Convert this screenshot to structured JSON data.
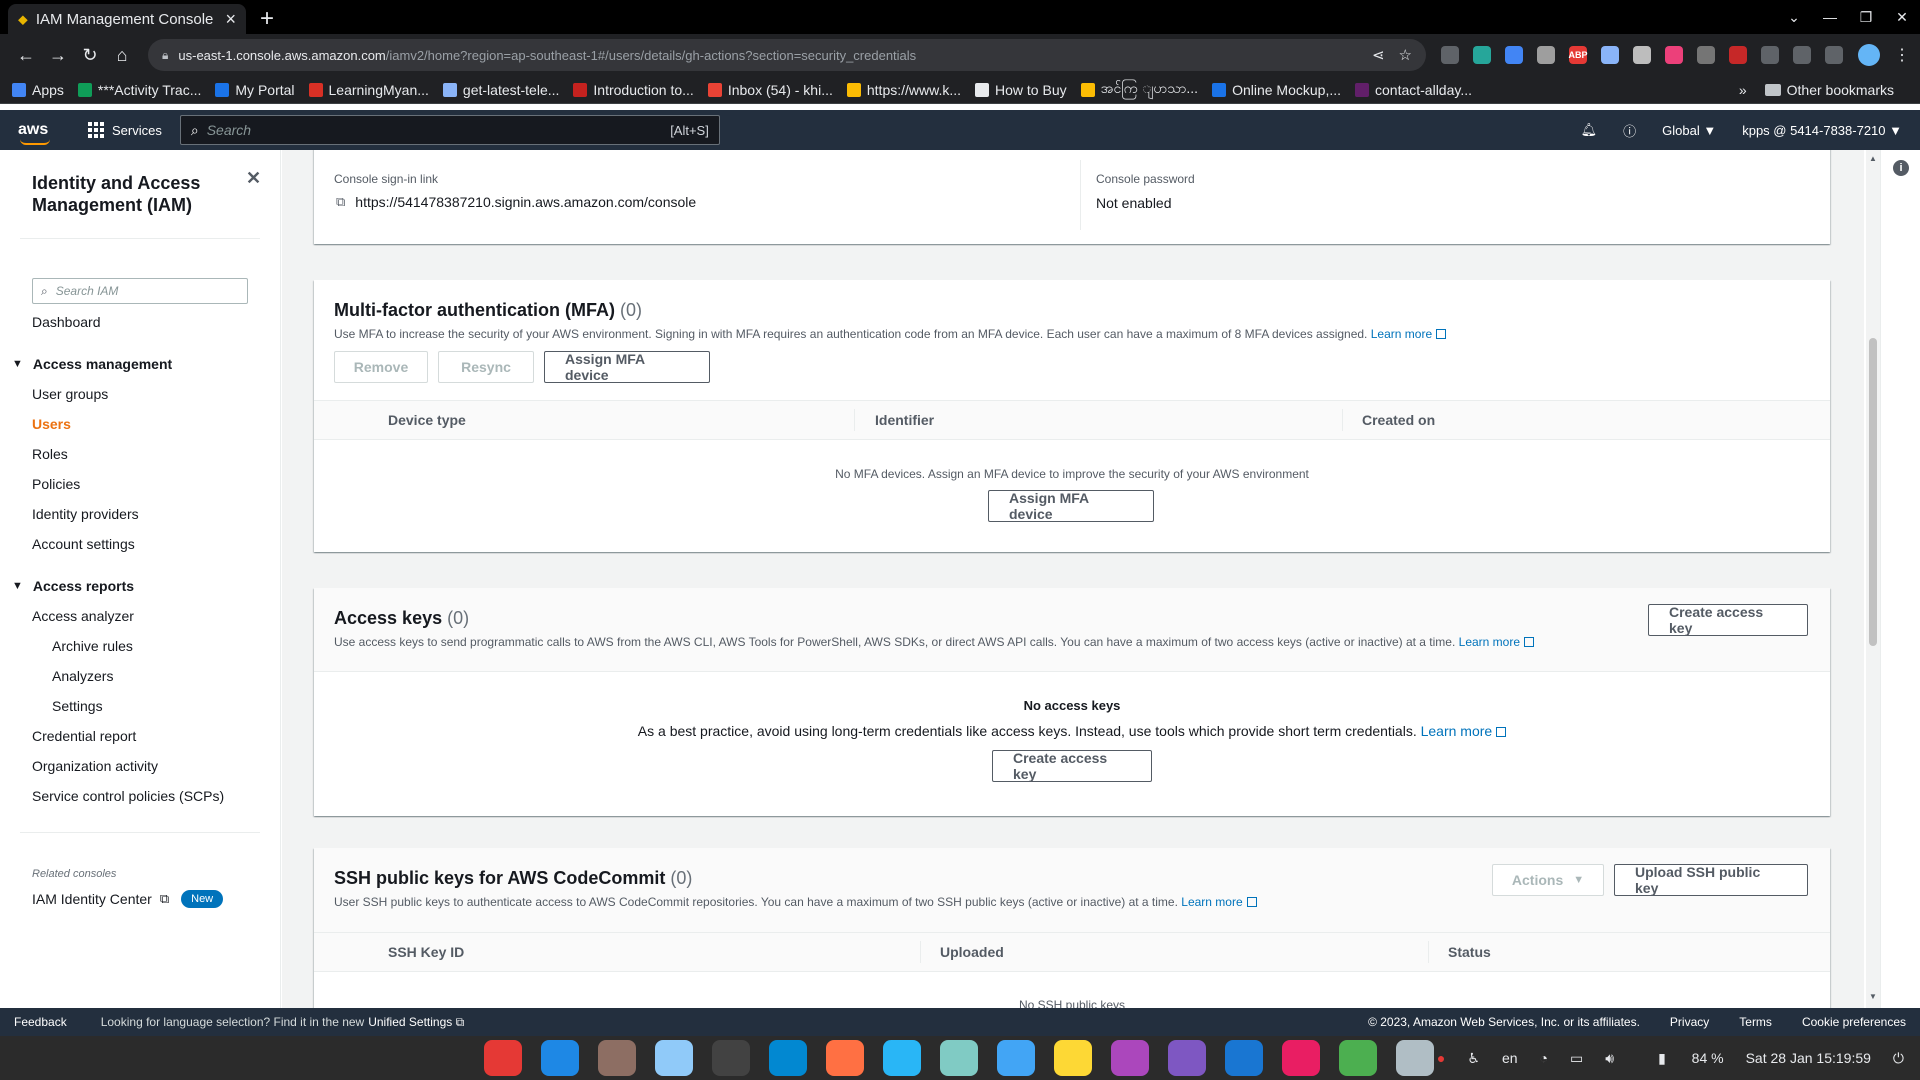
{
  "browser": {
    "tab_title": "IAM Management Console",
    "url_host": "us-east-1.console.aws.amazon.com",
    "url_path": "/iamv2/home?region=ap-southeast-1#/users/details/gh-actions?section=security_credentials",
    "bookmarks": [
      {
        "label": "Apps",
        "color": "#4285f4"
      },
      {
        "label": "***Activity Trac...",
        "color": "#0f9d58"
      },
      {
        "label": "My Portal",
        "color": "#1a73e8"
      },
      {
        "label": "LearningMyan...",
        "color": "#d93025"
      },
      {
        "label": "get-latest-tele...",
        "color": "#8ab4f8"
      },
      {
        "label": "Introduction to...",
        "color": "#c5221f"
      },
      {
        "label": "Inbox (54) - khi...",
        "color": "#ea4335"
      },
      {
        "label": "https://www.k...",
        "color": "#fbbc04"
      },
      {
        "label": "How to Buy",
        "color": "#e8eaed"
      },
      {
        "label": "အင်ကြ ျပာသာ...",
        "color": "#fbbc04"
      },
      {
        "label": "Online Mockup,...",
        "color": "#1a73e8"
      },
      {
        "label": "contact-allday...",
        "color": "#611f69"
      }
    ],
    "other_bookmarks": "Other bookmarks"
  },
  "aws_nav": {
    "logo": "aws",
    "services": "Services",
    "search_placeholder": "Search",
    "search_shortcut": "[Alt+S]",
    "region": "Global ▼",
    "account": "kpps @ 5414-7838-7210 ▼"
  },
  "sidebar": {
    "title": "Identity and Access Management (IAM)",
    "search_placeholder": "Search IAM",
    "dashboard": "Dashboard",
    "access_management": "Access management",
    "am_items": [
      "User groups",
      "Users",
      "Roles",
      "Policies",
      "Identity providers",
      "Account settings"
    ],
    "access_reports": "Access reports",
    "access_analyzer": "Access analyzer",
    "analyzer_items": [
      "Archive rules",
      "Analyzers",
      "Settings"
    ],
    "ar_items": [
      "Credential report",
      "Organization activity",
      "Service control policies (SCPs)"
    ],
    "related": "Related consoles",
    "iam_identity_center": "IAM Identity Center",
    "new_badge": "New"
  },
  "console": {
    "signin_label": "Console sign-in link",
    "signin_url": "https://541478387210.signin.aws.amazon.com/console",
    "password_label": "Console password",
    "password_value": "Not enabled"
  },
  "mfa": {
    "title": "Multi-factor authentication (MFA)",
    "count": "(0)",
    "desc": "Use MFA to increase the security of your AWS environment. Signing in with MFA requires an authentication code from an MFA device. Each user can have a maximum of 8 MFA devices assigned.",
    "learn_more": "Learn more",
    "btn_remove": "Remove",
    "btn_resync": "Resync",
    "btn_assign": "Assign MFA device",
    "cols": [
      "Device type",
      "Identifier",
      "Created on"
    ],
    "empty": "No MFA devices. Assign an MFA device to improve the security of your AWS environment",
    "empty_btn": "Assign MFA device"
  },
  "access_keys": {
    "title": "Access keys",
    "count": "(0)",
    "desc": "Use access keys to send programmatic calls to AWS from the AWS CLI, AWS Tools for PowerShell, AWS SDKs, or direct AWS API calls. You can have a maximum of two access keys (active or inactive) at a time.",
    "learn_more": "Learn more",
    "btn_create": "Create access key",
    "empty_title": "No access keys",
    "empty_desc": "As a best practice, avoid using long-term credentials like access keys. Instead, use tools which provide short term credentials.",
    "empty_learn": "Learn more",
    "empty_btn": "Create access key"
  },
  "ssh": {
    "title": "SSH public keys for AWS CodeCommit",
    "count": "(0)",
    "desc": "User SSH public keys to authenticate access to AWS CodeCommit repositories. You can have a maximum of two SSH public keys (active or inactive) at a time.",
    "learn_more": "Learn more",
    "btn_actions": "Actions",
    "btn_upload": "Upload SSH public key",
    "cols": [
      "SSH Key ID",
      "Uploaded",
      "Status"
    ],
    "empty": "No SSH public keys"
  },
  "footer": {
    "feedback": "Feedback",
    "lang_msg": "Looking for language selection? Find it in the new",
    "unified": "Unified Settings",
    "copyright": "© 2023, Amazon Web Services, Inc. or its affiliates.",
    "privacy": "Privacy",
    "terms": "Terms",
    "cookies": "Cookie preferences"
  },
  "taskbar": {
    "lang": "en",
    "battery": "84 %",
    "datetime": "Sat 28 Jan  15:19:59",
    "app_colors": [
      "#e53935",
      "#1e88e5",
      "#8d6e63",
      "#90caf9",
      "#424242",
      "#0288d1",
      "#ff7043",
      "#29b6f6",
      "#80cbc4",
      "#42a5f5",
      "#fdd835",
      "#ab47bc",
      "#7e57c2",
      "#1976d2",
      "#e91e63",
      "#4caf50",
      "#b0bec5"
    ]
  }
}
